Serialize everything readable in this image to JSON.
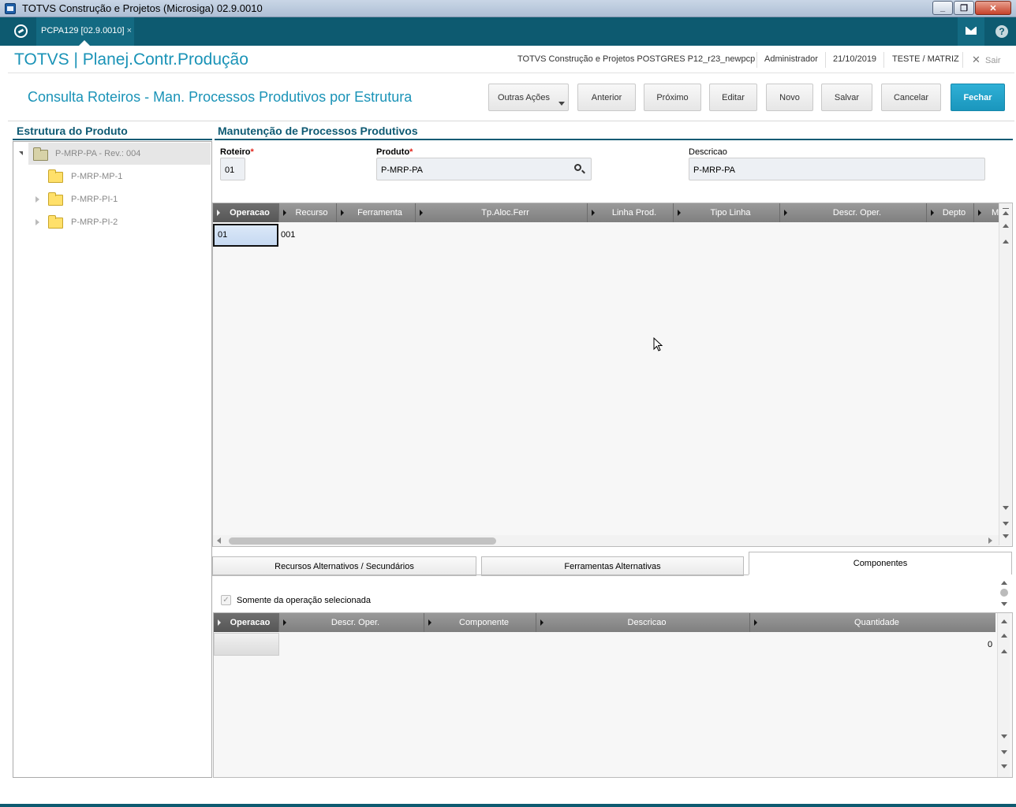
{
  "window": {
    "title": "TOTVS Construção e Projetos (Microsiga) 02.9.0010"
  },
  "tab": {
    "label": "PCPA129 [02.9.0010]",
    "close": "×"
  },
  "topbar": {
    "help": "?"
  },
  "header": {
    "app_title": "TOTVS | Planej.Contr.Produção",
    "environment": "TOTVS Construção e Projetos POSTGRES P12_r23_newpcp",
    "user": "Administrador",
    "date": "21/10/2019",
    "company": "TESTE / MATRIZ",
    "exit_label": "Sair"
  },
  "page": {
    "title": "Consulta Roteiros - Man. Processos Produtivos por Estrutura"
  },
  "toolbar": {
    "outras_acoes": "Outras Ações",
    "anterior": "Anterior",
    "proximo": "Próximo",
    "editar": "Editar",
    "novo": "Novo",
    "salvar": "Salvar",
    "cancelar": "Cancelar",
    "fechar": "Fechar"
  },
  "left": {
    "title": "Estrutura do Produto",
    "root": "P-MRP-PA - Rev.: 004",
    "children": [
      "P-MRP-MP-1",
      "P-MRP-PI-1",
      "P-MRP-PI-2"
    ]
  },
  "form": {
    "title": "Manutenção de Processos Produtivos",
    "roteiro_label": "Roteiro",
    "roteiro_value": "01",
    "produto_label": "Produto",
    "produto_value": "P-MRP-PA",
    "descricao_label": "Descricao",
    "descricao_value": "P-MRP-PA",
    "required_mark": "*"
  },
  "ops_grid": {
    "columns": [
      "Operacao",
      "Recurso",
      "Ferramenta",
      "Tp.Aloc.Ferr",
      "Linha Prod.",
      "Tipo Linha",
      "Descr. Oper.",
      "Depto",
      "M"
    ],
    "rows": [
      [
        "01",
        "001"
      ]
    ]
  },
  "subtabs": [
    "Recursos Alternativos / Secundários",
    "Ferramentas Alternativas",
    "Componentes"
  ],
  "components": {
    "checkbox_label": "Somente da operação selecionada",
    "checkbox_mark": "✓",
    "columns": [
      "Operacao",
      "Descr. Oper.",
      "Componente",
      "Descricao",
      "Quantidade"
    ],
    "quantity_value": "0"
  }
}
